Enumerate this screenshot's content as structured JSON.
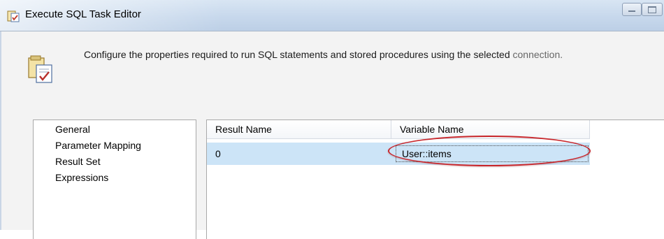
{
  "window": {
    "title": "Execute SQL Task Editor"
  },
  "header": {
    "description_main": "Configure the properties required to run SQL statements and stored procedures using the selected",
    "description_tail": "connection."
  },
  "nav": {
    "items": [
      {
        "label": "General"
      },
      {
        "label": "Parameter Mapping"
      },
      {
        "label": "Result Set"
      },
      {
        "label": "Expressions"
      }
    ]
  },
  "result_set": {
    "columns": [
      "Result Name",
      "Variable Name"
    ],
    "rows": [
      {
        "result_name": "0",
        "variable_name": "User::items"
      }
    ]
  },
  "colors": {
    "selected_row": "#cce4f7",
    "highlight_ellipse": "#c8262b",
    "titlebar": "#c7d8ec"
  }
}
